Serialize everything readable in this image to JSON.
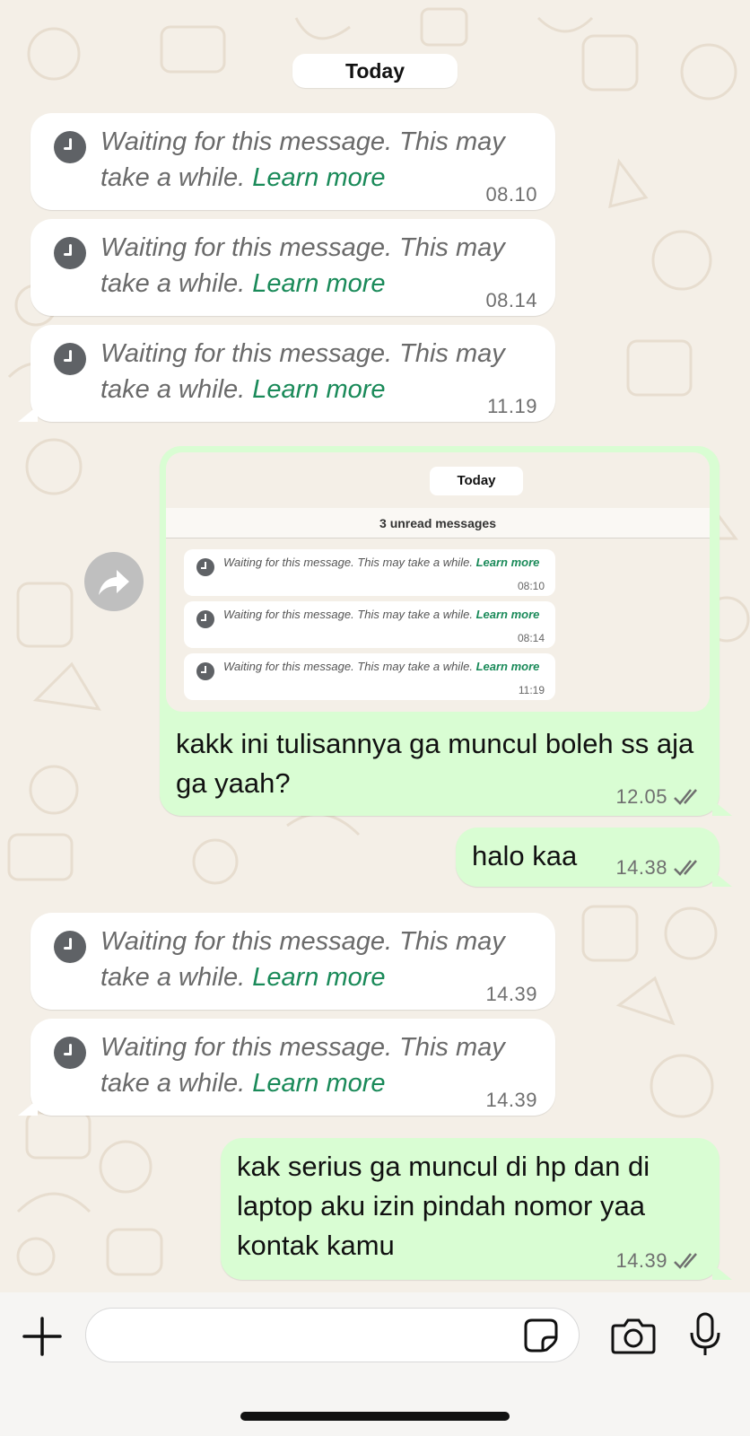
{
  "chat": {
    "date_label": "Today",
    "pending_message": {
      "text": "Waiting for this message. This may take a while.",
      "learn_more": "Learn more"
    },
    "incoming_times": [
      "08.10",
      "08.14",
      "11.19",
      "14.39",
      "14.39"
    ],
    "screenshot_message": {
      "date_label": "Today",
      "unread_label": "3 unread messages",
      "pending_text": "Waiting for this message. This may take a while.",
      "learn_more": "Learn more",
      "times": [
        "08:10",
        "08:14",
        "11:19"
      ],
      "caption": "kakk ini tulisannya ga muncul boleh ss aja ga yaah?",
      "time": "12.05",
      "status": "read"
    },
    "outgoing": [
      {
        "text": "halo kaa",
        "time": "14.38",
        "status": "read"
      },
      {
        "text": "kak serius ga muncul di hp dan di laptop aku izin pindah nomor yaa kontak kamu",
        "time": "14.39",
        "status": "read"
      }
    ]
  },
  "input_bar": {
    "message_value": "",
    "icons": [
      "plus-icon",
      "sticker-icon",
      "camera-icon",
      "microphone-icon"
    ]
  },
  "colors": {
    "wallpaper": "#f4efe7",
    "outgoing_bubble": "#d9fdd3",
    "incoming_bubble": "#ffffff",
    "link_green": "#1a8a59",
    "read_ticks": "#6f6f6f"
  }
}
